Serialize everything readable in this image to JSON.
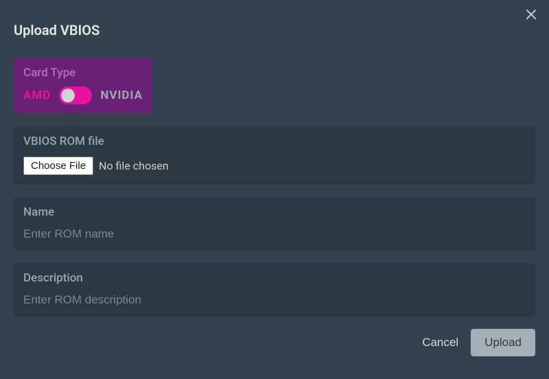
{
  "dialog": {
    "title": "Upload VBIOS"
  },
  "card_type": {
    "title": "Card Type",
    "left_label": "AMD",
    "right_label": "NVIDIA"
  },
  "file_block": {
    "label": "VBIOS ROM file",
    "button_label": "Choose File",
    "status_text": "No file chosen"
  },
  "name_block": {
    "label": "Name",
    "placeholder": "Enter ROM name",
    "value": ""
  },
  "description_block": {
    "label": "Description",
    "placeholder": "Enter ROM description",
    "value": ""
  },
  "footer": {
    "cancel_label": "Cancel",
    "upload_label": "Upload"
  }
}
